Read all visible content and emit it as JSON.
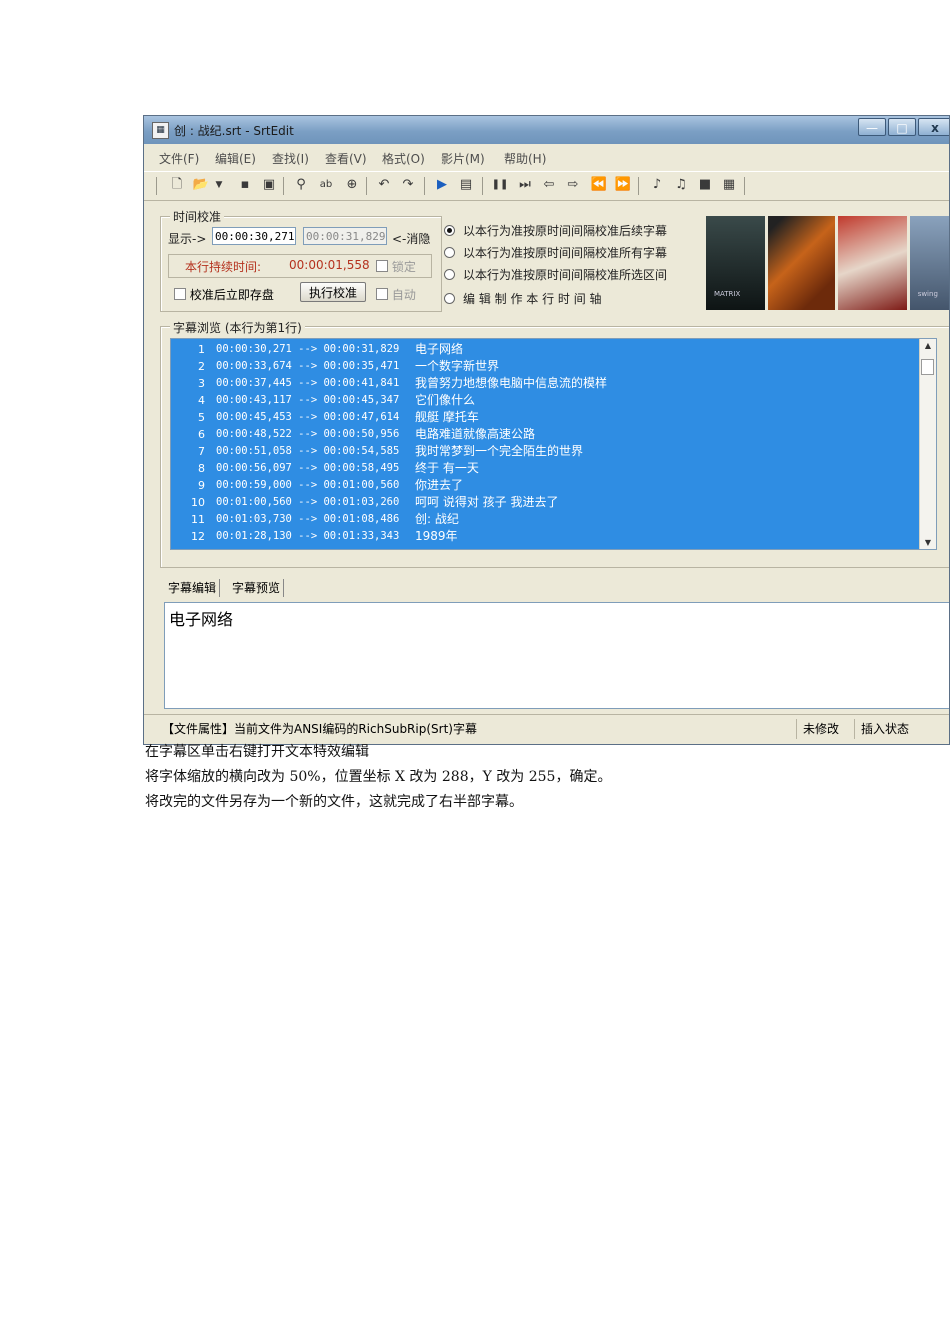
{
  "window": {
    "title": "创 : 战纪.srt - SrtEdit",
    "controls": {
      "min": "—",
      "max": "□",
      "close": "x"
    }
  },
  "menu": [
    "文件(F)",
    "编辑(E)",
    "查找(I)",
    "查看(V)",
    "格式(O)",
    "影片(M)",
    "帮助(H)"
  ],
  "toolbar_icons": [
    "new-icon",
    "open-icon",
    "dropdown-icon",
    "save-icon",
    "save-as-icon",
    "find-icon",
    "replace-icon",
    "zoom-find-icon",
    "undo-icon",
    "redo-icon",
    "play-icon",
    "movie-icon",
    "pause-icon",
    "step-end-icon",
    "prev-icon",
    "next-icon",
    "rewind-icon",
    "fast-forward-icon",
    "mark-in-icon",
    "mark-out-icon",
    "film-icon",
    "export-icon"
  ],
  "calibration": {
    "group_title": "时间校准",
    "display_label": "显示->",
    "start_time": "00:00:30,271",
    "end_time": "00:00:31,829",
    "hide_label": "<-消隐",
    "duration_label": "本行持续时间:",
    "duration_value": "00:00:01,558",
    "lock_label": "锁定",
    "save_after_label": "校准后立即存盘",
    "run_button": "执行校准",
    "auto_label": "自动",
    "options": [
      "以本行为准按原时间间隔校准后续字幕",
      "以本行为准按原时间间隔校准所有字幕",
      "以本行为准按原时间间隔校准所选区间",
      "编 辑 制 作 本 行 时 间 轴"
    ],
    "selected_option": 0
  },
  "posters": [
    {
      "caption": "MATRIX",
      "color": "#1f2a2a"
    },
    {
      "caption": "",
      "color": "#a44a10"
    },
    {
      "caption": "",
      "color": "#9a2520"
    },
    {
      "caption": "swing",
      "color": "#6b7e92"
    }
  ],
  "browser": {
    "group_title": "字幕浏览 (本行为第1行)",
    "rows": [
      {
        "no": "1",
        "start": "00:00:30,271",
        "end": "00:00:31,829",
        "text": "电子网络"
      },
      {
        "no": "2",
        "start": "00:00:33,674",
        "end": "00:00:35,471",
        "text": "一个数字新世界"
      },
      {
        "no": "3",
        "start": "00:00:37,445",
        "end": "00:00:41,841",
        "text": "我曾努力地想像电脑中信息流的模样"
      },
      {
        "no": "4",
        "start": "00:00:43,117",
        "end": "00:00:45,347",
        "text": "它们像什么"
      },
      {
        "no": "5",
        "start": "00:00:45,453",
        "end": "00:00:47,614",
        "text": "舰艇 摩托车"
      },
      {
        "no": "6",
        "start": "00:00:48,522",
        "end": "00:00:50,956",
        "text": "电路难道就像高速公路"
      },
      {
        "no": "7",
        "start": "00:00:51,058",
        "end": "00:00:54,585",
        "text": "我时常梦到一个完全陌生的世界"
      },
      {
        "no": "8",
        "start": "00:00:56,097",
        "end": "00:00:58,495",
        "text": "终于 有一天"
      },
      {
        "no": "9",
        "start": "00:00:59,000",
        "end": "00:01:00,560",
        "text": "你进去了"
      },
      {
        "no": "10",
        "start": "00:01:00,560",
        "end": "00:01:03,260",
        "text": "呵呵 说得对 孩子 我进去了"
      },
      {
        "no": "11",
        "start": "00:01:03,730",
        "end": "00:01:08,486",
        "text": "创: 战纪"
      },
      {
        "no": "12",
        "start": "00:01:28,130",
        "end": "00:01:33,343",
        "text": "1989年"
      }
    ],
    "arrow": "-->"
  },
  "editor": {
    "tabs": [
      "字幕编辑",
      "字幕预览"
    ],
    "content": "电子网络"
  },
  "status": {
    "file_info": "【文件属性】当前文件为ANSI编码的RichSubRip(Srt)字幕",
    "modified": "未修改",
    "mode": "插入状态"
  },
  "doc_lines": [
    "在字幕区单击右键打开文本特效编辑",
    "将字体缩放的横向改为 50%，位置坐标 X 改为 288，Y 改为 255，确定。",
    "将改完的文件另存为一个新的文件，这就完成了右半部字幕。"
  ]
}
